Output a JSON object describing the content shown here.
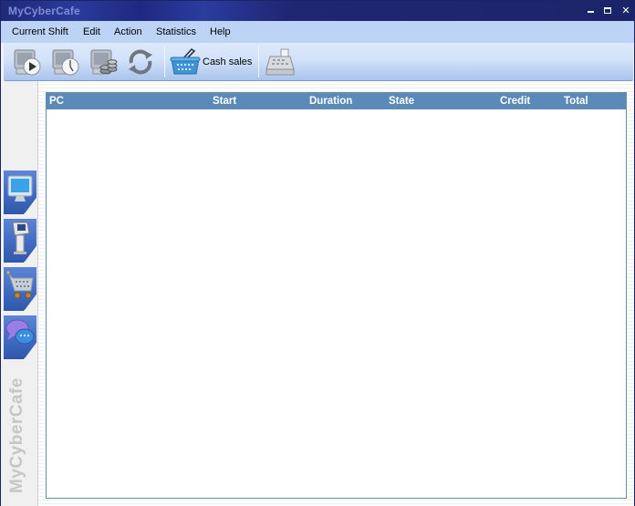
{
  "window": {
    "title": "MyCyberCafe",
    "controls": {
      "minimize": "minimize",
      "maximize": "maximize",
      "close": "close"
    }
  },
  "menu": {
    "items": [
      {
        "label": "Current Shift"
      },
      {
        "label": "Edit"
      },
      {
        "label": "Action"
      },
      {
        "label": "Statistics"
      },
      {
        "label": "Help"
      }
    ]
  },
  "toolbar": {
    "buttons": [
      {
        "icon": "start-session-icon",
        "label": ""
      },
      {
        "icon": "timed-session-icon",
        "label": ""
      },
      {
        "icon": "prepaid-session-icon",
        "label": ""
      },
      {
        "icon": "refresh-icon",
        "label": ""
      },
      {
        "icon": "shopping-basket-icon",
        "label": "Cash sales"
      },
      {
        "icon": "cash-register-icon",
        "label": ""
      }
    ]
  },
  "sidebar": {
    "items": [
      {
        "icon": "computer-monitor-icon",
        "name": "computers"
      },
      {
        "icon": "kiosk-terminal-icon",
        "name": "terminals"
      },
      {
        "icon": "shopping-cart-icon",
        "name": "shop"
      },
      {
        "icon": "chat-bubbles-icon",
        "name": "messages"
      }
    ],
    "brand_text": "MyCyberCafe"
  },
  "grid": {
    "columns": [
      {
        "label": "PC"
      },
      {
        "label": "Start"
      },
      {
        "label": "Duration"
      },
      {
        "label": "State"
      },
      {
        "label": "Credit"
      },
      {
        "label": "Total"
      }
    ],
    "rows": []
  },
  "colors": {
    "titlebar": "#1c2466",
    "title_text": "#7d8fd8",
    "menubar": "#bcd3f5",
    "grid_header": "#5b89b8",
    "sidebar_button": "#3f69c0"
  }
}
